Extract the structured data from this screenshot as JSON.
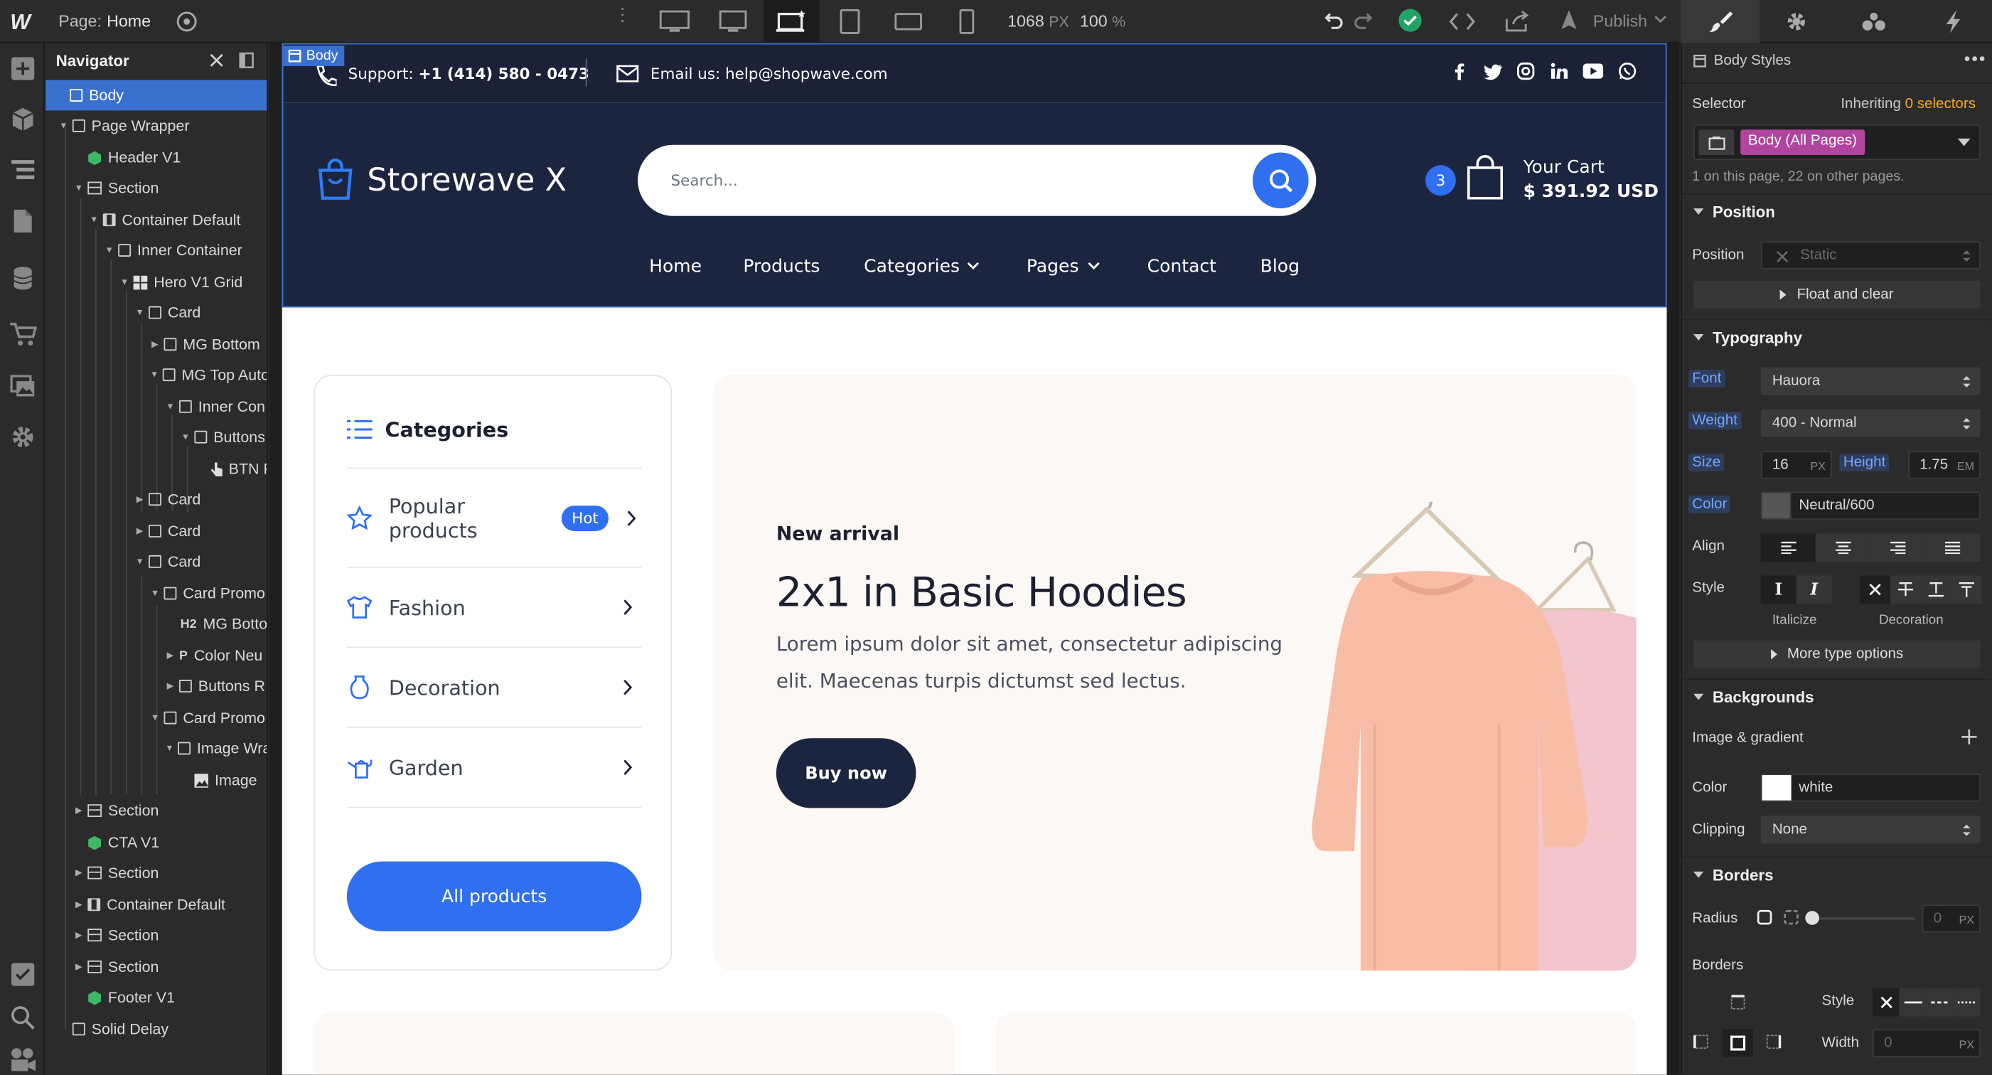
{
  "topbar": {
    "logo": "W",
    "page_label": "Page:",
    "page_name": "Home",
    "canvas_width": "1068",
    "canvas_unit": "PX",
    "zoom": "100",
    "zoom_unit": "%",
    "publish_label": "Publish"
  },
  "navigator": {
    "title": "Navigator",
    "items": [
      {
        "label": "Body"
      },
      {
        "label": "Page Wrapper"
      },
      {
        "label": "Header V1"
      },
      {
        "label": "Section"
      },
      {
        "label": "Container Default"
      },
      {
        "label": "Inner Container"
      },
      {
        "label": "Hero V1 Grid"
      },
      {
        "label": "Card"
      },
      {
        "label": "MG Bottom"
      },
      {
        "label": "MG Top Auto"
      },
      {
        "label": "Inner Con"
      },
      {
        "label": "Buttons"
      },
      {
        "label": "BTN P"
      },
      {
        "label": "Card"
      },
      {
        "label": "Card"
      },
      {
        "label": "Card"
      },
      {
        "label": "Card Promo"
      },
      {
        "label": "MG Bottom"
      },
      {
        "label": "Color Neu"
      },
      {
        "label": "Buttons R"
      },
      {
        "label": "Card Promo"
      },
      {
        "label": "Image Wra"
      },
      {
        "label": "Image"
      },
      {
        "label": "Section"
      },
      {
        "label": "CTA V1"
      },
      {
        "label": "Section"
      },
      {
        "label": "Container Default"
      },
      {
        "label": "Section"
      },
      {
        "label": "Section"
      },
      {
        "label": "Footer V1"
      },
      {
        "label": "Solid Delay"
      }
    ],
    "h2_tag": "H2",
    "p_tag": "P"
  },
  "canvas": {
    "selection_tag": "Body",
    "support_label": "Support:",
    "support_phone": "+1 (414) 580 - 0473",
    "email_label": "Email us:",
    "email_value": "help@shopwave.com",
    "brand_name": "Storewave X",
    "search_placeholder": "Search...",
    "cart_count": "3",
    "cart_title": "Your Cart",
    "cart_total": "$ 391.92 USD",
    "nav": [
      "Home",
      "Products",
      "Categories",
      "Pages",
      "Contact",
      "Blog"
    ],
    "categories_title": "Categories",
    "categories": [
      {
        "label": "Popular products",
        "icon": "star-icon",
        "badge": "Hot"
      },
      {
        "label": "Fashion",
        "icon": "shirt-icon"
      },
      {
        "label": "Decoration",
        "icon": "vase-icon"
      },
      {
        "label": "Garden",
        "icon": "watering-can-icon"
      }
    ],
    "all_products_label": "All products",
    "promo_eyebrow": "New arrival",
    "promo_title": "2x1 in Basic Hoodies",
    "promo_text": "Lorem ipsum dolor sit amet, consectetur adipiscing elit. Maecenas turpis dictumst sed lectus.",
    "promo_button": "Buy now"
  },
  "style_panel": {
    "header": "Body Styles",
    "selector_label": "Selector",
    "inheriting": "Inheriting",
    "inheriting_count": "0 selectors",
    "selector_value": "Body (All Pages)",
    "selector_note": "1 on this page, 22 on other pages.",
    "position_section": "Position",
    "position_label": "Position",
    "position_value": "Static",
    "float_clear": "Float and clear",
    "typography_section": "Typography",
    "font_label": "Font",
    "font_value": "Hauora",
    "weight_label": "Weight",
    "weight_value": "400 - Normal",
    "size_label": "Size",
    "size_value": "16",
    "size_unit": "PX",
    "height_label": "Height",
    "height_value": "1.75",
    "height_unit": "EM",
    "color_label": "Color",
    "color_value": "Neutral/600",
    "align_label": "Align",
    "style_label": "Style",
    "italicize_label": "Italicize",
    "decoration_label": "Decoration",
    "more_type": "More type options",
    "backgrounds_section": "Backgrounds",
    "image_gradient": "Image & gradient",
    "bg_color_label": "Color",
    "bg_color_value": "white",
    "clipping_label": "Clipping",
    "clipping_value": "None",
    "borders_section": "Borders",
    "radius_label": "Radius",
    "radius_value": "0",
    "radius_unit": "PX",
    "borders_label": "Borders",
    "border_style_label": "Style",
    "border_width_label": "Width",
    "border_width_value": "0",
    "border_width_unit": "PX"
  },
  "colors": {
    "accent": "#3a71cf",
    "brand_blue": "#2f6ff0",
    "header_navy": "#1c2540",
    "webflow_green": "#21a366",
    "selector_pink": "#b0449e"
  }
}
